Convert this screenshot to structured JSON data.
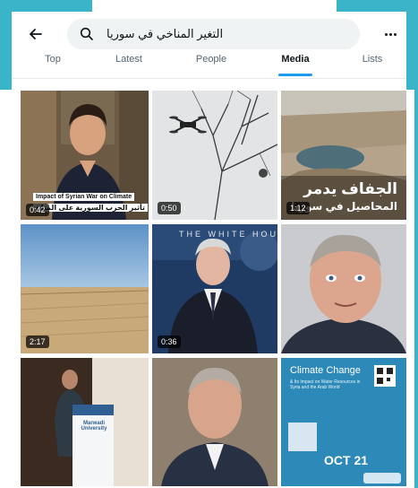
{
  "colors": {
    "frame": "#3ab4c8",
    "accent": "#1d9bf0"
  },
  "header": {
    "back_icon": "arrow-left-icon",
    "search_icon": "search-icon",
    "search_query": "التغير المناخي في سوريا",
    "more_icon": "more-horizontal-icon"
  },
  "tabs": [
    {
      "label": "Top",
      "active": false
    },
    {
      "label": "Latest",
      "active": false
    },
    {
      "label": "People",
      "active": false
    },
    {
      "label": "Media",
      "active": true
    },
    {
      "label": "Lists",
      "active": false
    }
  ],
  "media": [
    {
      "kind": "video",
      "duration": "0:42",
      "caption_en": "Impact of Syrian War on Climate",
      "caption_ar": "تأثير الحرب السورية على المناخ"
    },
    {
      "kind": "video",
      "duration": "0:50"
    },
    {
      "kind": "video",
      "duration": "1:12",
      "caption_ar_1": "الجفاف يدمر",
      "caption_ar_2": "المحاصيل في سوريا"
    },
    {
      "kind": "video",
      "duration": "2:17"
    },
    {
      "kind": "video",
      "duration": "0:36",
      "sign_text": "THE WHITE HOUSE"
    },
    {
      "kind": "image"
    },
    {
      "kind": "image",
      "podium_text": "Marwadi University"
    },
    {
      "kind": "image"
    },
    {
      "kind": "image",
      "title": "Climate Change",
      "subtitle": "& Its Impact on Water Resources in Syria and the Arab World",
      "date": "OCT 21"
    }
  ]
}
